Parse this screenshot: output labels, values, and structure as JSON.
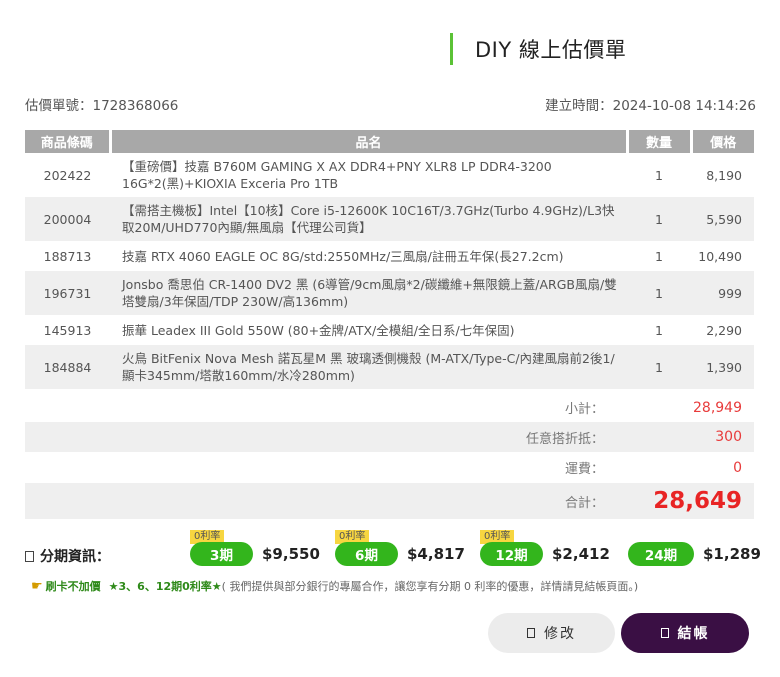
{
  "header": {
    "title": "DIY 線上估價單"
  },
  "meta": {
    "quote_no": "估價單號：1728368066",
    "created_at": "建立時間：2024-10-08 14:14:26"
  },
  "table": {
    "headers": [
      "商品條碼",
      "品名",
      "數量",
      "價格"
    ],
    "rows": [
      {
        "code": "202422",
        "name": "【重磅價】技嘉 B760M GAMING X AX DDR4+PNY XLR8 LP DDR4-3200 16G*2(黑)+KIOXIA Exceria Pro 1TB",
        "qty": "1",
        "price": "8,190"
      },
      {
        "code": "200004",
        "name": "【需搭主機板】Intel【10核】Core i5-12600K 10C16T/3.7GHz(Turbo 4.9GHz)/L3快取20M/UHD770內顯/無風扇【代理公司貨】",
        "qty": "1",
        "price": "5,590"
      },
      {
        "code": "188713",
        "name": "技嘉 RTX 4060 EAGLE OC 8G/std:2550MHz/三風扇/註冊五年保(長27.2cm)",
        "qty": "1",
        "price": "10,490"
      },
      {
        "code": "196731",
        "name": "Jonsbo 喬思伯 CR-1400 DV2 黑 (6導管/9cm風扇*2/碳纖維+無限鏡上蓋/ARGB風扇/雙塔雙扇/3年保固/TDP 230W/高136mm)",
        "qty": "1",
        "price": "999"
      },
      {
        "code": "145913",
        "name": "振華 Leadex III Gold 550W (80+金牌/ATX/全模組/全日系/七年保固)",
        "qty": "1",
        "price": "2,290"
      },
      {
        "code": "184884",
        "name": "火鳥 BitFenix Nova Mesh 諾瓦星M 黑 玻璃透側機殼 (M-ATX/Type-C/內建風扇前2後1/顯卡345mm/塔散160mm/水冷280mm)",
        "qty": "1",
        "price": "1,390"
      }
    ]
  },
  "summary": {
    "subtotal_label": "小計：",
    "subtotal": "28,949",
    "discount_label": "任意搭折抵：",
    "discount": "300",
    "shipping_label": "運費：",
    "shipping": "0",
    "total_label": "合計：",
    "total": "28,649"
  },
  "installments": {
    "label": "分期資訊：",
    "plans": [
      {
        "term": "3期",
        "price": "$9,550",
        "tag": "0利率"
      },
      {
        "term": "6期",
        "price": "$4,817",
        "tag": "0利率"
      },
      {
        "term": "12期",
        "price": "$2,412",
        "tag": "0利率"
      },
      {
        "term": "24期",
        "price": "$1,289",
        "tag": ""
      }
    ]
  },
  "promo": {
    "prefix": "刷卡不加價",
    "highlight": "★3、6、12期0利率★",
    "note": "( 我們提供與部分銀行的專屬合作，讓您享有分期 0 利率的優惠，詳情請見結帳頁面。)"
  },
  "buttons": {
    "edit": "修改",
    "checkout": "結帳"
  },
  "colors": {
    "accent_green": "#33b51c",
    "total_red": "#e82424",
    "checkout_purple": "#3a0f44",
    "title_bar": "#5bc236"
  }
}
